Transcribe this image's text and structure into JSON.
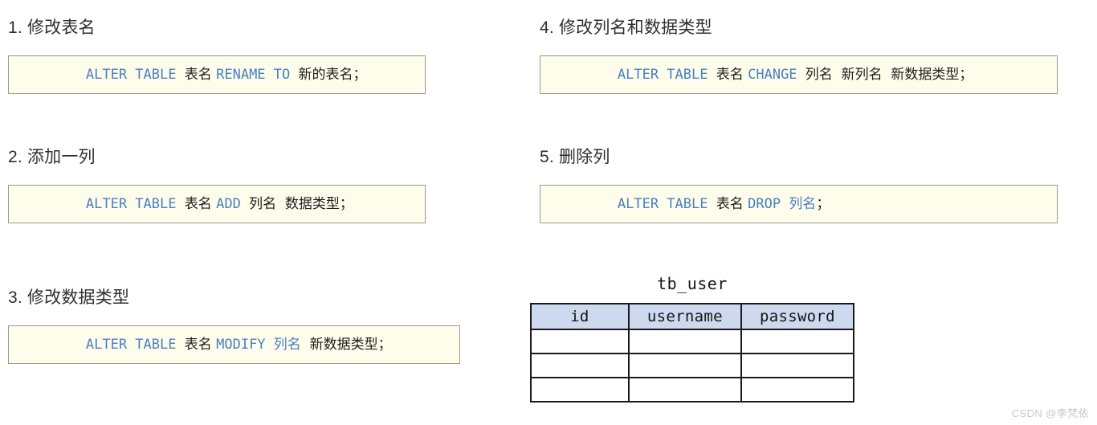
{
  "sections": [
    {
      "id": "rename-table",
      "title": "1. 修改表名",
      "tokens": [
        {
          "text": "ALTER TABLE ",
          "type": "keyword"
        },
        {
          "text": "表名 ",
          "type": "plain-cn"
        },
        {
          "text": "RENAME TO ",
          "type": "keyword"
        },
        {
          "text": "新的表名；",
          "type": "plain-cn"
        }
      ],
      "code_plain": "ALTER TABLE 表名 RENAME TO 新的表名；"
    },
    {
      "id": "add-column",
      "title": "2. 添加一列",
      "tokens": [
        {
          "text": "ALTER TABLE ",
          "type": "keyword"
        },
        {
          "text": "表名 ",
          "type": "plain-cn"
        },
        {
          "text": "ADD ",
          "type": "keyword"
        },
        {
          "text": "列名  数据类型；",
          "type": "plain-cn"
        }
      ],
      "code_plain": "ALTER TABLE 表名 ADD 列名 数据类型；"
    },
    {
      "id": "modify-datatype",
      "title": "3. 修改数据类型",
      "tokens": [
        {
          "text": "ALTER TABLE ",
          "type": "keyword"
        },
        {
          "text": "表名 ",
          "type": "plain-cn"
        },
        {
          "text": "MODIFY ",
          "type": "keyword"
        },
        {
          "text": "列名 ",
          "type": "keyword-cn"
        },
        {
          "text": " 新数据类型；",
          "type": "plain-cn"
        }
      ],
      "code_plain": "ALTER TABLE 表名 MODIFY 列名 新数据类型；"
    },
    {
      "id": "change-column",
      "title": "4. 修改列名和数据类型",
      "tokens": [
        {
          "text": "ALTER TABLE ",
          "type": "keyword"
        },
        {
          "text": "表名 ",
          "type": "plain-cn"
        },
        {
          "text": "CHANGE ",
          "type": "keyword"
        },
        {
          "text": "列名  新列名  新数据类型；",
          "type": "plain-cn"
        }
      ],
      "code_plain": "ALTER TABLE 表名 CHANGE 列名 新列名 新数据类型；"
    },
    {
      "id": "drop-column",
      "title": "5. 删除列",
      "tokens": [
        {
          "text": "ALTER TABLE ",
          "type": "keyword"
        },
        {
          "text": "表名 ",
          "type": "plain-cn"
        },
        {
          "text": "DROP ",
          "type": "keyword"
        },
        {
          "text": "列名",
          "type": "keyword-cn"
        },
        {
          "text": "；",
          "type": "plain-cn"
        }
      ],
      "code_plain": "ALTER TABLE 表名 DROP 列名；"
    }
  ],
  "table_figure": {
    "caption": "tb_user",
    "columns": [
      "id",
      "username",
      "password"
    ],
    "rows": [
      [
        "",
        "",
        ""
      ],
      [
        "",
        "",
        ""
      ],
      [
        "",
        "",
        ""
      ]
    ]
  },
  "watermark": "CSDN @李梵依",
  "colors": {
    "keyword": "#4a80c2",
    "code_background": "#fefdeb",
    "code_border": "#9a9a8e",
    "table_header_background": "#ccd9ee",
    "table_border": "#1a1a1a",
    "text": "#2f2f2f",
    "watermark": "#c8c8c8"
  }
}
